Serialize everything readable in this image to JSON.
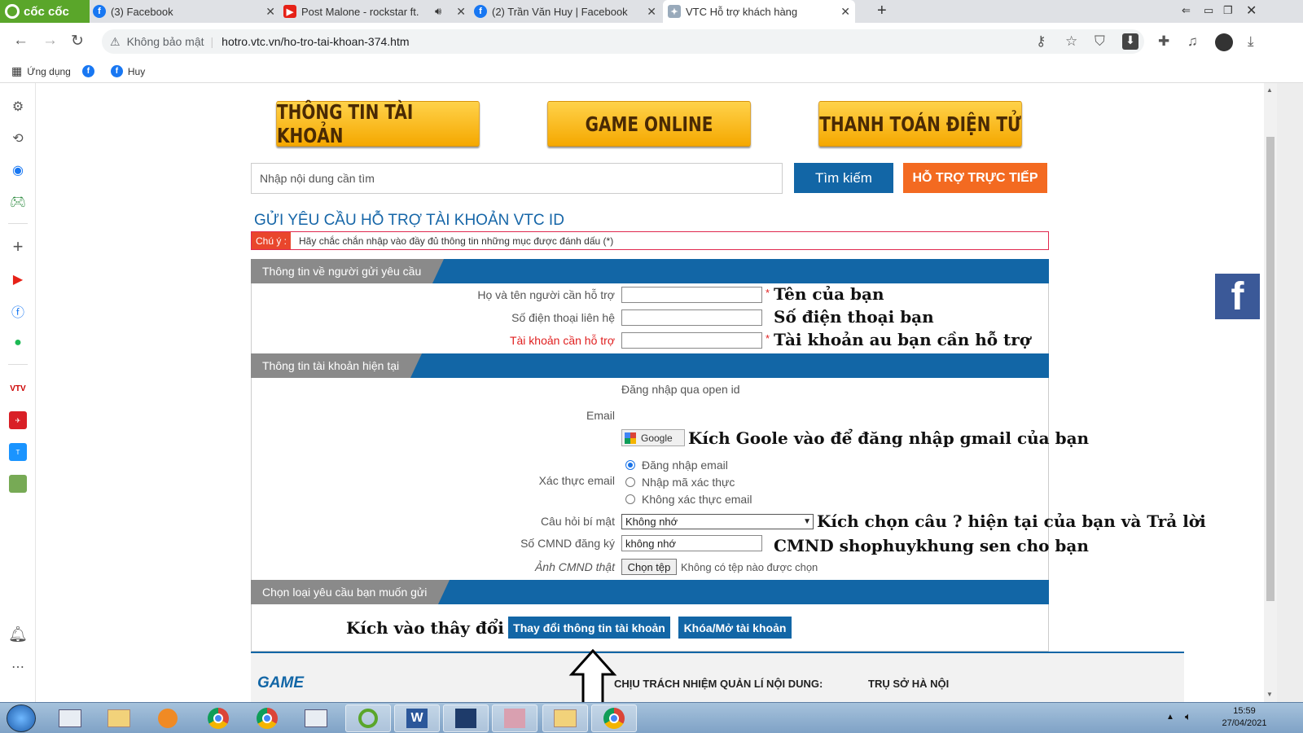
{
  "browser": {
    "brand": "cốc cốc",
    "tabs": [
      {
        "title": "(3) Facebook"
      },
      {
        "title": "Post Malone - rockstar ft."
      },
      {
        "title": "(2) Trần Văn Huy | Facebook"
      },
      {
        "title": "VTC Hỗ trợ khách hàng"
      }
    ],
    "security_label": "Không bảo mật",
    "url": "hotro.vtc.vn/ho-tro-tai-khoan-374.htm",
    "bookmarks": [
      {
        "label": "Ứng dụng"
      },
      {
        "label": ""
      },
      {
        "label": "Huy"
      }
    ]
  },
  "header": {
    "nav": [
      {
        "label": "THÔNG TIN TÀI KHOẢN"
      },
      {
        "label": "GAME ONLINE"
      },
      {
        "label": "THANH TOÁN ĐIỆN TỬ"
      }
    ],
    "search_placeholder": "Nhập nội dung cần tìm",
    "search_button": "Tìm kiếm",
    "live_support_button": "HỖ TRỢ TRỰC TIẾP"
  },
  "form": {
    "title": "GỬI YÊU CẦU HỖ TRỢ TÀI KHOẢN VTC ID",
    "note_label": "Chú ý :",
    "note_text": "Hãy chắc chắn nhập vào đầy đủ thông tin những mục được đánh dấu (*)",
    "section1": {
      "title": "Thông tin về người gửi yêu cầu",
      "fullname_label": "Họ và tên người cần hỗ trợ",
      "phone_label": "Số điện thoại liên hệ",
      "account_label": "Tài khoản cần hỗ trợ",
      "required_mark": "*"
    },
    "section2": {
      "title": "Thông tin tài khoản hiện tại",
      "openid_text": "Đăng nhập qua open id",
      "email_label": "Email",
      "google_button": "Google",
      "verify_label": "Xác thực email",
      "verify_options": [
        {
          "label": "Đăng nhập email",
          "checked": true
        },
        {
          "label": "Nhập mã xác thực",
          "checked": false
        },
        {
          "label": "Không xác thực email",
          "checked": false
        }
      ],
      "secret_q_label": "Câu hỏi bí mật",
      "secret_q_value": "Không nhớ",
      "id_label": "Số CMND đăng ký",
      "id_value": "không nhớ",
      "photo_label": "Ảnh CMND thật",
      "file_button": "Chọn tệp",
      "file_status": "Không có tệp nào được chọn"
    },
    "section3": {
      "title": "Chọn loại yêu cầu bạn muốn gửi",
      "change_button": "Thay đổi thông tin tài khoản",
      "lock_button": "Khóa/Mở tài khoản"
    }
  },
  "annotations": {
    "name": "Tên của bạn",
    "phone": "Số điện thoại bạn",
    "account": "Tài khoản au bạn cần hỗ trợ",
    "google": "Kích Goole vào để đăng nhập gmail của bạn",
    "question": "Kích chọn câu ? hiện tại của bạn và Trả lời",
    "id": "CMND shophuykhung sen cho bạn",
    "click": "Kích vào thây đổi"
  },
  "footer": {
    "logo": "GAME",
    "responsibility": "CHỊU TRÁCH NHIỆM QUẢN LÍ NỘI DUNG:",
    "office": "TRỤ SỞ HÀ NỘI"
  },
  "taskbar": {
    "time": "15:59",
    "date": "27/04/2021"
  },
  "colors": {
    "accent_blue": "#1266a6",
    "orange": "#f36a21",
    "gold": "#f5a800",
    "note_red": "#e9462c"
  }
}
